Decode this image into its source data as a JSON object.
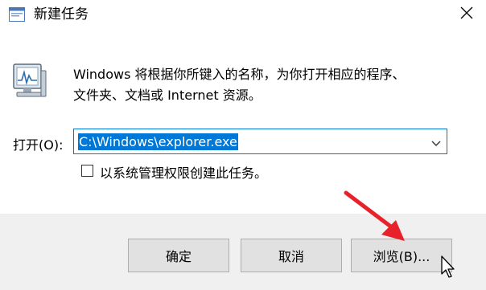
{
  "window": {
    "title": "新建任务"
  },
  "icons": {
    "app": "run-app-icon",
    "close": "close-icon",
    "monitor": "monitor-icon",
    "dropdown": "chevron-down-icon",
    "annotation_arrow": "red-arrow-annotation",
    "cursor": "mouse-pointer-icon"
  },
  "dialog": {
    "description_line1": "Windows 将根据你所键入的名称，为你打开相应的程序、",
    "description_line2": "文件夹、文档或 Internet 资源。",
    "open_label": "打开(O):",
    "open_value": "C:\\Windows\\explorer.exe",
    "admin_checkbox_label": "以系统管理权限创建此任务。",
    "admin_checkbox_checked": false
  },
  "buttons": {
    "ok": "确定",
    "cancel": "取消",
    "browse": "浏览(B)..."
  },
  "colors": {
    "accent": "#0078d7",
    "annotation": "#e8222b",
    "footer_bg": "#f0f0f0"
  }
}
